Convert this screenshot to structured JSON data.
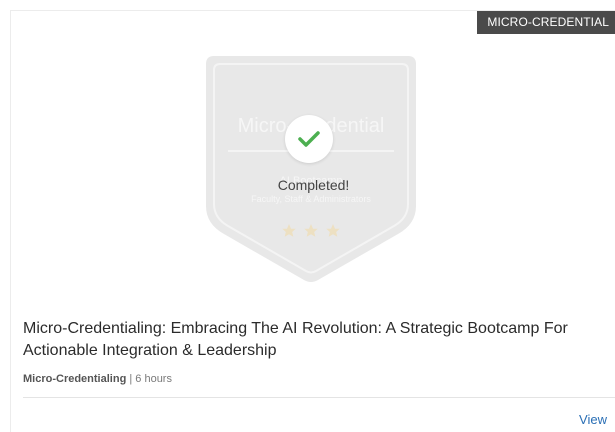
{
  "card": {
    "category_tag": "MICRO-CREDENTIAL",
    "badge": {
      "line1": "Micro-Credential",
      "line2": "AI Bootcamp",
      "line3": "Faculty, Staff & Administrators",
      "status_label": "Completed!"
    },
    "title": "Micro-Credentialing: Embracing The AI Revolution: A Strategic Bootcamp For Actionable Integration & Leadership",
    "meta": {
      "category": "Micro-Credentialing",
      "separator": " | ",
      "duration": "6 hours"
    },
    "view_label": "View"
  },
  "colors": {
    "tag_background": "#4a4a4a",
    "check_green": "#4caf50",
    "link_blue": "#2a6fb5"
  },
  "icons": {
    "status": "checkmark-icon",
    "rating": "star-icon"
  }
}
